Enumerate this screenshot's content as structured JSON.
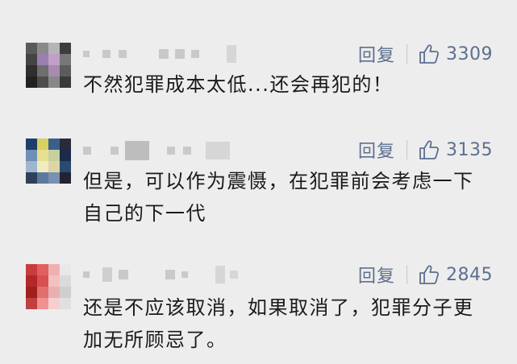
{
  "comments": [
    {
      "reply_label": "回复",
      "likes": "3309",
      "text": "不然犯罪成本太低...还会再犯的！",
      "avatar_colors": [
        "#5a5a5a",
        "#8a8a8a",
        "#b5b5b5",
        "#3d3d3d",
        "#444",
        "#9a7fb0",
        "#c0a0c8",
        "#777",
        "#2f2f2f",
        "#6e6e6e",
        "#a78cae",
        "#5c5c5c",
        "#222",
        "#4d4d4d",
        "#888",
        "#3a3a3a"
      ]
    },
    {
      "reply_label": "回复",
      "likes": "3135",
      "text": "但是，可以作为震慑，在犯罪前会考虑一下自己的下一代",
      "avatar_colors": [
        "#1f3d6a",
        "#d8d060",
        "#3a5f8c",
        "#2a2a3a",
        "#6f8fb4",
        "#e6e090",
        "#c8d0a0",
        "#1b2b4a",
        "#9fb6d0",
        "#f0ecc0",
        "#dcd5a8",
        "#2a4a70",
        "#30405a",
        "#5a7aa0",
        "#7a90b0",
        "#223"
      ]
    },
    {
      "reply_label": "回复",
      "likes": "2845",
      "text": "还是不应该取消，如果取消了，犯罪分子更加无所顾忌了。",
      "avatar_colors": [
        "#c83c3c",
        "#e06060",
        "#f0b0b0",
        "#e8e8e8",
        "#b02828",
        "#d85050",
        "#f4c0c0",
        "#dadada",
        "#a02020",
        "#e07070",
        "#eab0b0",
        "#cfcfcf",
        "#c04040",
        "#f09090",
        "#f6d0d0",
        "#e0e0e0"
      ]
    }
  ],
  "colors": {
    "background": "#ededed",
    "action": "#5d6f8f",
    "text": "#1a1a1a"
  },
  "icons": {
    "like": "thumbs-up-icon"
  }
}
